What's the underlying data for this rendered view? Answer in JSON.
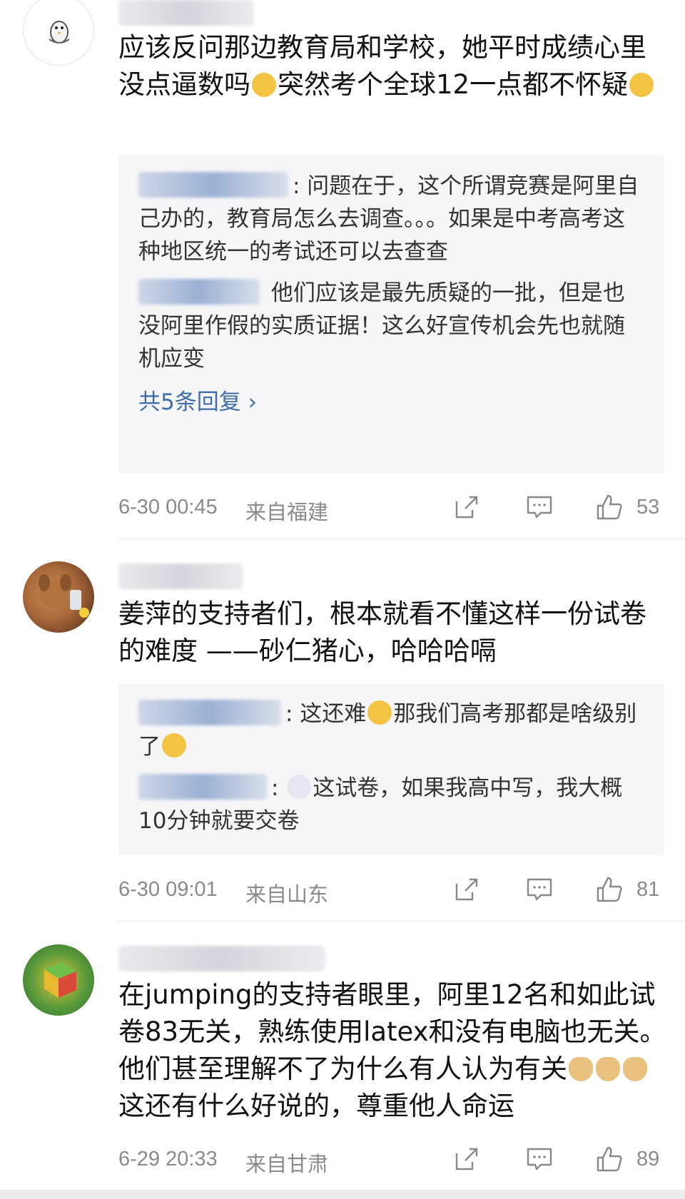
{
  "comments": [
    {
      "text_before": "应该反问那边教育局和学校，她平时成绩心里没点逼数吗",
      "text_mid": "突然考个全球12一点都不怀疑",
      "replies": [
        {
          "text": ": 问题在于，这个所谓竞赛是阿里自己办的，教育局怎么去调查。。。如果是中考高考这种地区统一的考试还可以去查查"
        },
        {
          "text": " 他们应该是最先质疑的一批，但是也没阿里作假的实质证据！这么好宣传机会先也就随机应变"
        }
      ],
      "more_replies": "共5条回复 ›",
      "time": "6-30 00:45",
      "location": "来自福建",
      "likes": "53"
    },
    {
      "text": "姜萍的支持者们，根本就看不懂这样一份试卷的难度  ——砂仁猪心，哈哈哈嗝",
      "reply1_a": ": 这还难",
      "reply1_b": "那我们高考那都是啥级别了",
      "reply2_a": ": ",
      "reply2_b": "这试卷，如果我高中写，我大概10分钟就要交卷",
      "time": "6-30 09:01",
      "location": "来自山东",
      "likes": "81"
    },
    {
      "text_before": "在jumping的支持者眼里，阿里12名和如此试卷83无关，熟练使用latex和没有电脑也无关。他们甚至理解不了为什么有人认为有关",
      "text_after": "这还有什么好说的，尊重他人命运",
      "time": "6-29 20:33",
      "location": "来自甘肃",
      "likes": "89"
    }
  ],
  "icons": {
    "share": "share-icon",
    "comment": "comment-icon",
    "like": "thumbs-up-icon"
  }
}
